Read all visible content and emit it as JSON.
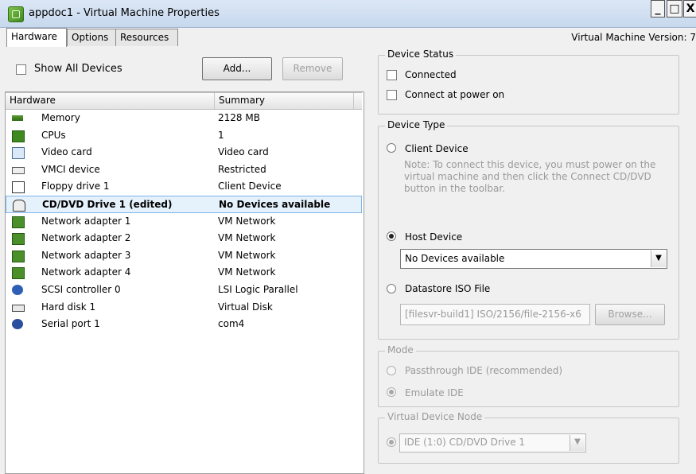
{
  "window": {
    "title": "appdoc1 - Virtual Machine Properties",
    "minimize": "_",
    "maximize": "□",
    "close": "X"
  },
  "tabs": [
    "Hardware",
    "Options",
    "Resources"
  ],
  "vm_version": "Virtual Machine Version: 7",
  "hardware_panel": {
    "show_all_devices": "Show All Devices",
    "add_button": "Add...",
    "remove_button": "Remove",
    "columns": [
      "Hardware",
      "Summary"
    ],
    "rows": [
      {
        "icon": "memory-icon",
        "name": "Memory",
        "summary": "2128 MB"
      },
      {
        "icon": "cpu-icon",
        "name": "CPUs",
        "summary": "1"
      },
      {
        "icon": "video-card-icon",
        "name": "Video card",
        "summary": "Video card"
      },
      {
        "icon": "vmci-device-icon",
        "name": "VMCI device",
        "summary": "Restricted"
      },
      {
        "icon": "floppy-drive-icon",
        "name": "Floppy drive 1",
        "summary": "Client Device"
      },
      {
        "icon": "cd-dvd-drive-icon",
        "name": "CD/DVD Drive 1 (edited)",
        "summary": "No Devices available",
        "selected": true
      },
      {
        "icon": "network-adapter-icon",
        "name": "Network adapter 1",
        "summary": "VM Network"
      },
      {
        "icon": "network-adapter-icon",
        "name": "Network adapter 2",
        "summary": "VM Network"
      },
      {
        "icon": "network-adapter-icon",
        "name": "Network adapter 3",
        "summary": "VM Network"
      },
      {
        "icon": "network-adapter-icon",
        "name": "Network adapter 4",
        "summary": "VM Network"
      },
      {
        "icon": "scsi-controller-icon",
        "name": "SCSI controller 0",
        "summary": "LSI Logic Parallel"
      },
      {
        "icon": "hard-disk-icon",
        "name": "Hard disk 1",
        "summary": "Virtual Disk"
      },
      {
        "icon": "serial-port-icon",
        "name": "Serial port 1",
        "summary": "com4"
      }
    ]
  },
  "device_status": {
    "title": "Device Status",
    "connected": "Connected",
    "connect_at_power_on": "Connect at power on"
  },
  "device_type": {
    "title": "Device Type",
    "client_device": "Client Device",
    "client_note": "Note: To connect this device, you must power on the virtual machine and then click the Connect CD/DVD button in the toolbar.",
    "host_device": "Host Device",
    "host_select_value": "No Devices available",
    "datastore_iso": "Datastore ISO File",
    "iso_path": "[filesvr-build1] ISO/2156/file-2156-x6",
    "browse_button": "Browse..."
  },
  "mode": {
    "title": "Mode",
    "passthrough": "Passthrough IDE (recommended)",
    "emulate": "Emulate IDE"
  },
  "virtual_device_node": {
    "title": "Virtual Device Node",
    "value": "IDE (1:0) CD/DVD Drive 1"
  }
}
